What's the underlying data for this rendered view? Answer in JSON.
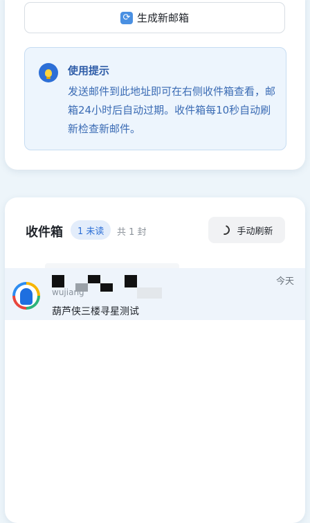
{
  "actions": {
    "generate_label": "生成新邮箱",
    "generate_icon": "refresh-emoji-icon"
  },
  "tip": {
    "icon": "lightbulb-icon",
    "title": "使用提示",
    "text": "发送邮件到此地址即可在右侧收件箱查看，邮箱24小时后自动过期。收件箱每10秒自动刷新检查新邮件。"
  },
  "inbox": {
    "title": "收件箱",
    "unread_badge": "1 未读",
    "total": "共 1 封",
    "refresh_label": "手动刷新",
    "refresh_icon": "refresh-icon",
    "messages": [
      {
        "avatar": "qq-mail-avatar",
        "sender": "wujiang",
        "subject": "葫芦侠三楼寻星测试",
        "time": "今天"
      }
    ]
  },
  "colors": {
    "accent": "#2d6fd6",
    "tip_bg": "#edf5fd",
    "page_bg": "#edf5fa"
  }
}
